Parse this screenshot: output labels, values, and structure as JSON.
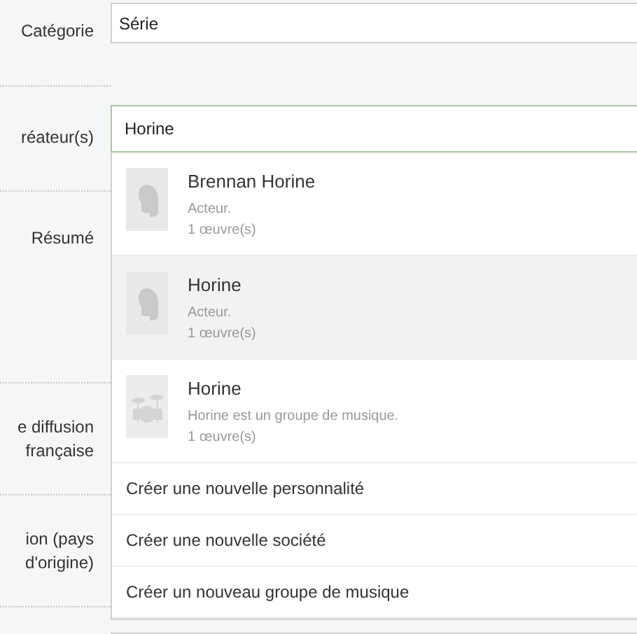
{
  "labels": [
    "Catégorie",
    "réateur(s)",
    "Résumé",
    "e diffusion\nfrançaise",
    "ion (pays\nd'origine)"
  ],
  "category_field": {
    "value": "Série"
  },
  "creators_field": {
    "value": "Horine"
  },
  "suggestions": [
    {
      "kind": "person",
      "name": "Brennan Horine",
      "description": "Acteur.",
      "works": "1 œuvre(s)",
      "selected": false
    },
    {
      "kind": "person",
      "name": "Horine",
      "description": "Acteur.",
      "works": "1 œuvre(s)",
      "selected": true
    },
    {
      "kind": "band",
      "name": "Horine",
      "description": "Horine est un groupe de musique.",
      "works": "1 œuvre(s)",
      "selected": false
    },
    {
      "kind": "action",
      "label": "Créer une nouvelle personnalité",
      "selected": false
    },
    {
      "kind": "action",
      "label": "Créer une nouvelle société",
      "selected": false
    },
    {
      "kind": "action",
      "label": "Créer un nouveau groupe de musique",
      "selected": false
    }
  ]
}
